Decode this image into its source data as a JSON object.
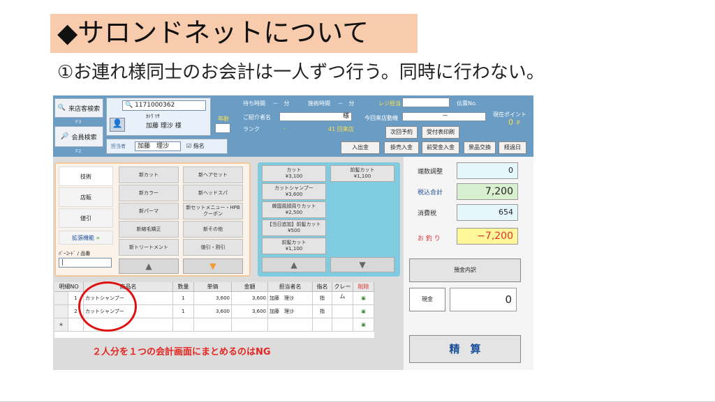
{
  "slide": {
    "title": "◆サロンドネットについて",
    "subtitle": "①お連れ様同士のお会計は一人ずつ行う。同時に行わない。",
    "annotation": "２人分を１つの会計画面にまとめるのはNG"
  },
  "app": {
    "visit_search": "来店客検索",
    "visit_search_key": "F3",
    "member_search": "会員検索",
    "member_search_key": "F2",
    "customer_id": "1171000362",
    "customer_kana": "ｶﾄｳ ﾘｻ",
    "customer_name": "加藤 理沙 様",
    "age_label": "年齢",
    "staff_label": "担当者",
    "staff_name": "加藤　理沙",
    "designate_label": "指名",
    "wait_time": "待ち時間　 －　分",
    "treatment_time": "施術時間　 －　分",
    "register_staff": "レジ担当",
    "slip_no": "伝票No.",
    "referrer": "ご紹介者名",
    "referrer_suffix": "様",
    "last_visit": "今回来店動機",
    "last_visit_value": "－",
    "points_label": "現在ポイント",
    "points_value": "0",
    "points_unit": "P",
    "rank": "ランク",
    "rank_value": "-",
    "visit_count": "41 回来店",
    "buttons": [
      "次回予約",
      "受付表印刷",
      "入出金",
      "掛売入金",
      "前受金入金",
      "景品交換",
      "経過日"
    ],
    "tabs": [
      "技術",
      "店販",
      "値引",
      "拡張機能"
    ],
    "barcode_label": "ﾊﾞｰｺｰﾄﾞ / 品番",
    "tech_menu": [
      "新カット",
      "新ヘアセット",
      "新カラー",
      "新ヘッドスパ",
      "新パーマ",
      "新セットメニュー・HPBクーポン",
      "新縮毛矯正",
      "新その他",
      "新トリートメント",
      "値引・割引"
    ],
    "mid_menu": [
      {
        "name": "カット",
        "price": "¥3,100"
      },
      {
        "name": "前髪カット",
        "price": "¥1,100"
      },
      {
        "name": "カットシャンプー",
        "price": "¥3,600"
      },
      {
        "name": "韓国風顔周りカット",
        "price": "¥2,500"
      },
      {
        "name": "【当日追加】前髪カット",
        "price": "¥500"
      },
      {
        "name": "前髪カット",
        "price": "¥1,100"
      }
    ],
    "table_headers": [
      "明細NO",
      "商品名",
      "数量",
      "単価",
      "金額",
      "担当者名",
      "指名",
      "クレーム",
      "削除"
    ],
    "rows": [
      {
        "no": "1",
        "item": "カットシャンプー",
        "qty": "1",
        "unit": "3,600",
        "amount": "3,600",
        "staff": "加藤　理沙",
        "designate": "指"
      },
      {
        "no": "2",
        "item": "カットシャンプー",
        "qty": "1",
        "unit": "3,600",
        "amount": "3,600",
        "staff": "加藤　理沙",
        "designate": "指"
      }
    ],
    "new_row_marker": "＊",
    "rounding_label": "端数調整",
    "rounding_value": "0",
    "total_label": "税込合計",
    "total_value": "7,200",
    "tax_label": "消費税",
    "tax_value": "654",
    "change_label": "お 釣 り",
    "change_value": "−7,200",
    "deposit_button": "預金内訳",
    "cash_label": "現金",
    "cash_value": "0",
    "checkout_button": "精　算"
  }
}
